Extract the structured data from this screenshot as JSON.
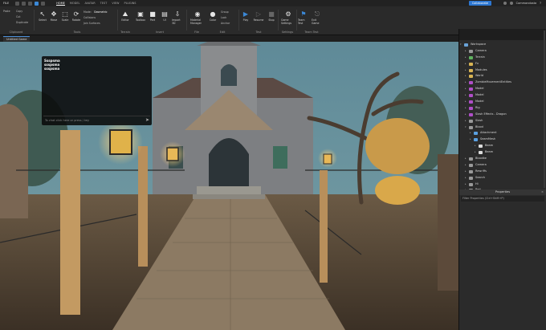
{
  "titlebar": {
    "file": "FILE",
    "tabs": [
      "HOME",
      "MODEL",
      "AVATAR",
      "TEST",
      "VIEW",
      "PLUGINS"
    ],
    "active_tab": "HOME",
    "collaborate_label": "Collaborate",
    "user": "Commandosta"
  },
  "ribbon": {
    "groups": [
      {
        "label": "Clipboard"
      },
      {
        "label": "Tools"
      },
      {
        "label": "Terrain"
      },
      {
        "label": "Insert"
      },
      {
        "label": "File"
      },
      {
        "label": "Edit"
      },
      {
        "label": "Test"
      },
      {
        "label": "Settings"
      },
      {
        "label": "Team Test"
      }
    ],
    "tools": {
      "select": "Select",
      "move": "Move",
      "scale": "Scale",
      "rotate": "Rotate",
      "editor": "Editor",
      "toolbox": "Toolbox",
      "part": "Part",
      "ui": "UI",
      "import3d": "Import 3D",
      "material": "Material Manager",
      "color": "Color",
      "group": "Group",
      "lock": "Lock",
      "anchor": "Anchor",
      "play": "Play",
      "resume": "Resume",
      "stop": "Stop",
      "game_settings": "Game Settings",
      "team_test": "Team Test",
      "exit_game": "Exit Game"
    },
    "mode_label": "Mode:",
    "mode_value": "Geometric",
    "collisions": "Collisions",
    "join_surfaces": "Join Surfaces",
    "clip_items": [
      "Paste",
      "Copy",
      "Cut",
      "Duplicate"
    ]
  },
  "document_tab": "Untitled Game",
  "chat": {
    "lines": [
      "Ssspsma",
      "ssspsma",
      "ssspsma"
    ],
    "input_placeholder": "To chat click here or press / key"
  },
  "explorer": {
    "nodes": [
      {
        "label": "Workspace",
        "depth": 0,
        "icon": "workspace",
        "color": "#6aa3d8",
        "expanded": true
      },
      {
        "label": "Camera",
        "depth": 1,
        "icon": "camera",
        "color": "#9a9a9a"
      },
      {
        "label": "Terrain",
        "depth": 1,
        "icon": "terrain",
        "color": "#5fb35f"
      },
      {
        "label": "Fx",
        "depth": 1,
        "icon": "folder",
        "color": "#d8b454"
      },
      {
        "label": "Modules",
        "depth": 1,
        "icon": "folder",
        "color": "#d8b454"
      },
      {
        "label": "World",
        "depth": 1,
        "icon": "folder",
        "color": "#d8b454"
      },
      {
        "label": "ZombieMovementEntities",
        "depth": 1,
        "icon": "model",
        "color": "#b04fc8"
      },
      {
        "label": "Model",
        "depth": 1,
        "icon": "model",
        "color": "#b04fc8"
      },
      {
        "label": "Model",
        "depth": 1,
        "icon": "model",
        "color": "#b04fc8"
      },
      {
        "label": "Model",
        "depth": 1,
        "icon": "model",
        "color": "#b04fc8"
      },
      {
        "label": "Rig",
        "depth": 1,
        "icon": "model",
        "color": "#b04fc8"
      },
      {
        "label": "Slash Effects - Dragon",
        "depth": 1,
        "icon": "model",
        "color": "#b04fc8"
      },
      {
        "label": "Slash",
        "depth": 1,
        "icon": "part",
        "color": "#9a9a9a"
      },
      {
        "label": "Blood",
        "depth": 1,
        "icon": "part",
        "color": "#9a9a9a",
        "expanded": true
      },
      {
        "label": "Attachment",
        "depth": 2,
        "icon": "attachment",
        "color": "#5aa0e0"
      },
      {
        "label": "SeamMesh",
        "depth": 2,
        "icon": "mesh",
        "color": "#5aa0e0"
      },
      {
        "label": "Beam",
        "depth": 3,
        "icon": "beam",
        "color": "#dcdcdc"
      },
      {
        "label": "Beam",
        "depth": 3,
        "icon": "beam",
        "color": "#dcdcdc"
      },
      {
        "label": "Bloodke",
        "depth": 1,
        "icon": "part",
        "color": "#9a9a9a"
      },
      {
        "label": "Camera",
        "depth": 1,
        "icon": "part",
        "color": "#9a9a9a"
      },
      {
        "label": "Rewriffs",
        "depth": 1,
        "icon": "part",
        "color": "#9a9a9a"
      },
      {
        "label": "Search",
        "depth": 1,
        "icon": "part",
        "color": "#9a9a9a"
      },
      {
        "label": "Hi",
        "depth": 1,
        "icon": "part",
        "color": "#9a9a9a"
      },
      {
        "label": "Part",
        "depth": 1,
        "icon": "part",
        "color": "#9a9a9a"
      }
    ]
  },
  "properties": {
    "title": "Properties",
    "filter_placeholder": "Filter Properties (Ctrl+Shift+P)"
  },
  "colors": {
    "accent": "#3b88d6",
    "collaborate": "#2d77d2",
    "panel": "#2b2b2b",
    "ribbon": "#2a2a2a"
  }
}
